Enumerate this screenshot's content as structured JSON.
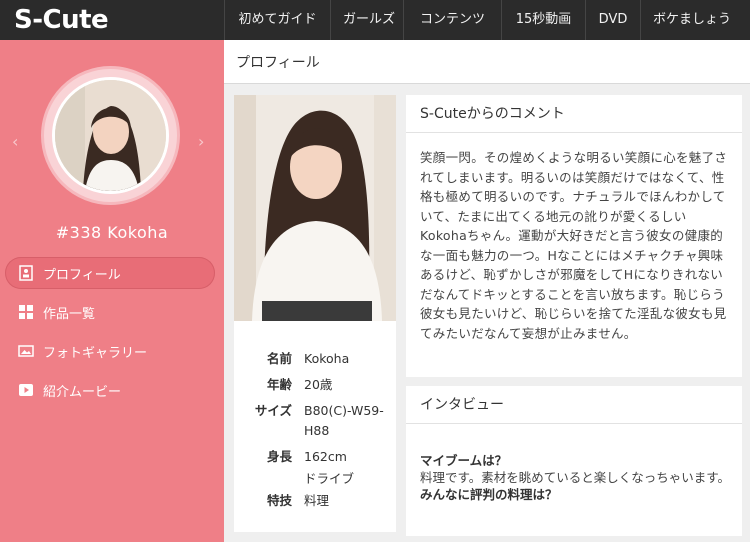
{
  "brand": {
    "logo": "S-Cute"
  },
  "nav": {
    "items": [
      "初めてガイド",
      "ガールズ",
      "コンテンツ",
      "15秒動画",
      "DVD",
      "ボケましょう"
    ]
  },
  "sidebar": {
    "model_name": "#338 Kokoha",
    "prev_arrow": "‹",
    "next_arrow": "›",
    "items": [
      {
        "label": "プロフィール",
        "icon": "profile-icon",
        "active": true
      },
      {
        "label": "作品一覧",
        "icon": "grid-icon",
        "active": false
      },
      {
        "label": "フォトギャラリー",
        "icon": "photo-icon",
        "active": false
      },
      {
        "label": "紹介ムービー",
        "icon": "play-icon",
        "active": false
      }
    ]
  },
  "main": {
    "header": "プロフィール",
    "profile": [
      {
        "label": "名前",
        "value": "Kokoha"
      },
      {
        "label": "年齢",
        "value": "20歳"
      },
      {
        "label": "サイズ",
        "value": "B80(C)-W59-H88"
      },
      {
        "label": "身長",
        "value": "162cm"
      },
      {
        "label": "",
        "value": "ドライブ"
      },
      {
        "label": "特技",
        "value": "料理"
      }
    ],
    "comment": {
      "title": "S-Cuteからのコメント",
      "text": "笑顔一閃。その煌めくような明るい笑顔に心を魅了されてしまいます。明るいのは笑顔だけではなくて、性格も極めて明るいのです。ナチュラルでほんわかしていて、たまに出てくる地元の訛りが愛くるしいKokohaちゃん。運動が大好きだと言う彼女の健康的な一面も魅力の一つ。Hなことにはメチャクチャ興味あるけど、恥ずかしさが邪魔をしてHになりきれないだなんてドキッとすることを言い放ちます。恥じらう彼女も見たいけど、恥じらいを捨てた淫乱な彼女も見てみたいだなんて妄想が止みません。"
    },
    "interview": {
      "title": "インタビュー",
      "q1": "マイブームは？",
      "a1": "料理です。素材を眺めていると楽しくなっちゃいます。",
      "q2": "みんなに評判の料理は？"
    }
  },
  "colors": {
    "nav_bg": "#2b2b2b",
    "sidebar_bg": "#ef7f87",
    "active_item_bg": "#e86d77"
  }
}
